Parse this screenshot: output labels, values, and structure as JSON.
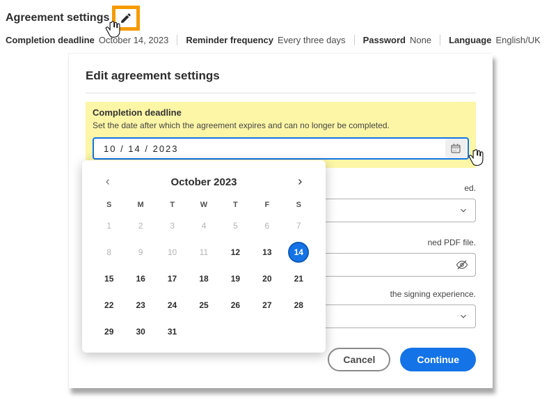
{
  "header": {
    "title": "Agreement settings",
    "summary": {
      "deadline_label": "Completion deadline",
      "deadline_value": "October 14, 2023",
      "reminder_label": "Reminder frequency",
      "reminder_value": "Every three days",
      "password_label": "Password",
      "password_value": "None",
      "language_label": "Language",
      "language_value": "English/UK"
    }
  },
  "dialog": {
    "title": "Edit agreement settings",
    "deadline_section": {
      "label": "Completion deadline",
      "desc": "Set the date after which the agreement expires and can no longer be completed.",
      "value": "10 / 14 / 2023"
    },
    "reminder_section": {
      "desc_suffix": "ed."
    },
    "password_section": {
      "desc_suffix": "ned PDF file."
    },
    "language_section": {
      "desc_suffix": "the signing experience."
    },
    "buttons": {
      "cancel": "Cancel",
      "continue": "Continue"
    }
  },
  "calendar": {
    "month_label": "October 2023",
    "dow": [
      "S",
      "M",
      "T",
      "W",
      "T",
      "F",
      "S"
    ],
    "days": [
      {
        "d": "1",
        "dim": true
      },
      {
        "d": "2",
        "dim": true
      },
      {
        "d": "3",
        "dim": true
      },
      {
        "d": "4",
        "dim": true
      },
      {
        "d": "5",
        "dim": true
      },
      {
        "d": "6",
        "dim": true
      },
      {
        "d": "7",
        "dim": true
      },
      {
        "d": "8",
        "dim": true
      },
      {
        "d": "9",
        "dim": true
      },
      {
        "d": "10",
        "dim": true
      },
      {
        "d": "11",
        "dim": true
      },
      {
        "d": "12",
        "bold": true
      },
      {
        "d": "13",
        "bold": true
      },
      {
        "d": "14",
        "sel": true
      },
      {
        "d": "15",
        "bold": true
      },
      {
        "d": "16",
        "bold": true
      },
      {
        "d": "17",
        "bold": true
      },
      {
        "d": "18",
        "bold": true
      },
      {
        "d": "19",
        "bold": true
      },
      {
        "d": "20",
        "bold": true
      },
      {
        "d": "21",
        "bold": true
      },
      {
        "d": "22",
        "bold": true
      },
      {
        "d": "23",
        "bold": true
      },
      {
        "d": "24",
        "bold": true
      },
      {
        "d": "25",
        "bold": true
      },
      {
        "d": "26",
        "bold": true
      },
      {
        "d": "27",
        "bold": true
      },
      {
        "d": "28",
        "bold": true
      },
      {
        "d": "29",
        "bold": true
      },
      {
        "d": "30",
        "bold": true
      },
      {
        "d": "31",
        "bold": true
      }
    ]
  }
}
